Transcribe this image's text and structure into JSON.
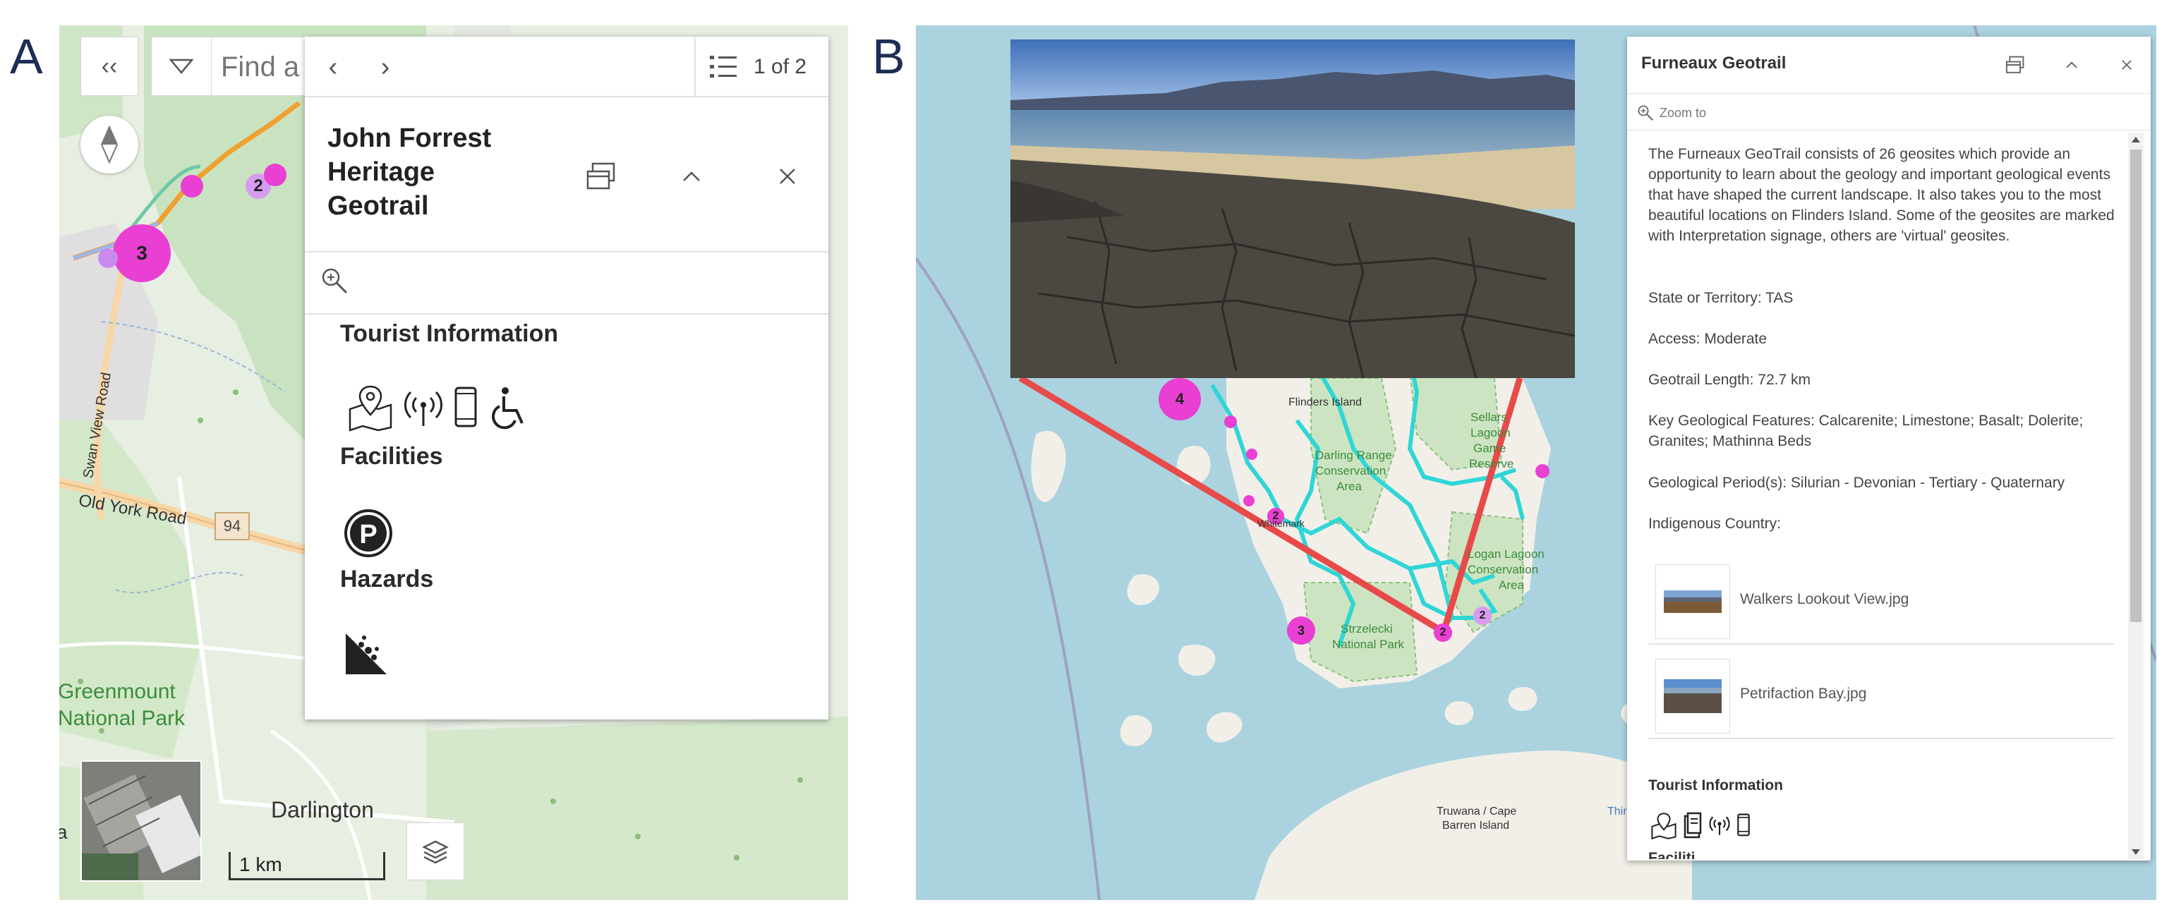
{
  "labels": {
    "a": "A",
    "b": "B"
  },
  "panel_a": {
    "search_placeholder": "Find a",
    "pager": "1 of 2",
    "popup_title": "John Forrest Heritage Geotrail",
    "tourist_info": "Tourist Information",
    "facilities": "Facilities",
    "hazards": "Hazards",
    "map_labels": {
      "swan_view_road": "Swan View Road",
      "old_york_road": "Old York Road",
      "route_94": "94",
      "greenmount": "Greenmount",
      "national_park": "National Park",
      "darlington": "Darlington",
      "edge_a": "a"
    },
    "scale": "1 km",
    "clusters": [
      "3",
      "2"
    ],
    "icons": [
      "map-pin-icon",
      "wifi-icon",
      "mobile-phone-icon",
      "wheelchair-icon",
      "parking-icon",
      "rockfall-icon",
      "search-zoom-icon",
      "dock-icon",
      "chevron-up-icon",
      "close-icon",
      "collapse-icon",
      "filter-icon",
      "list-icon",
      "compass-icon",
      "layers-icon"
    ]
  },
  "panel_b": {
    "popup_title": "Furneaux Geotrail",
    "zoom_to": "Zoom to",
    "description": "The Furneaux GeoTrail consists of 26 geosites which provide an opportunity to learn about the geology and important geological events that have shaped the current landscape. It also takes you to the most beautiful locations on Flinders Island. Some of the geosites are marked with Interpretation signage, others are 'virtual' geosites.",
    "state": "State or Territory: TAS",
    "access": "Access: Moderate",
    "length": "Geotrail Length: 72.7  km",
    "features": "Key Geological Features: Calcarenite; Limestone; Basalt; Dolerite; Granites; Mathinna Beds",
    "period": "Geological Period(s): Silurian - Devonian - Tertiary - Quaternary",
    "indigenous": "Indigenous Country:",
    "attachments": [
      "Walkers Lookout View.jpg",
      "Petrifaction Bay.jpg"
    ],
    "tourist_info": "Tourist Information",
    "facilities_partial": "Faciliti",
    "map_labels": {
      "flinders_island": "Flinders Island",
      "sellars": "Sellars",
      "lagoon": "Lagoon",
      "game": "Game",
      "reserve": "Reserve",
      "strzelecki": "Strzelecki",
      "national_park": "National Park",
      "truwana": "Truwana / Cape",
      "barren_island": "Barren Island",
      "logan_lagoon": "Logan Lagoon",
      "conservation": "Conservation",
      "area": "Area",
      "darling_range": "Darling Range",
      "conservation2": "Conservation",
      "area2": "Area",
      "whitemark": "Whitemark",
      "third": "Third"
    },
    "clusters": [
      "4",
      "2",
      "3",
      "2",
      "2"
    ],
    "colors": {
      "trail": "#2fd6d6",
      "cluster": "#e93fd3",
      "pointer": "#e84a4a",
      "water": "#aad3df",
      "land": "#f2efe9",
      "park": "#cde4c2"
    }
  }
}
